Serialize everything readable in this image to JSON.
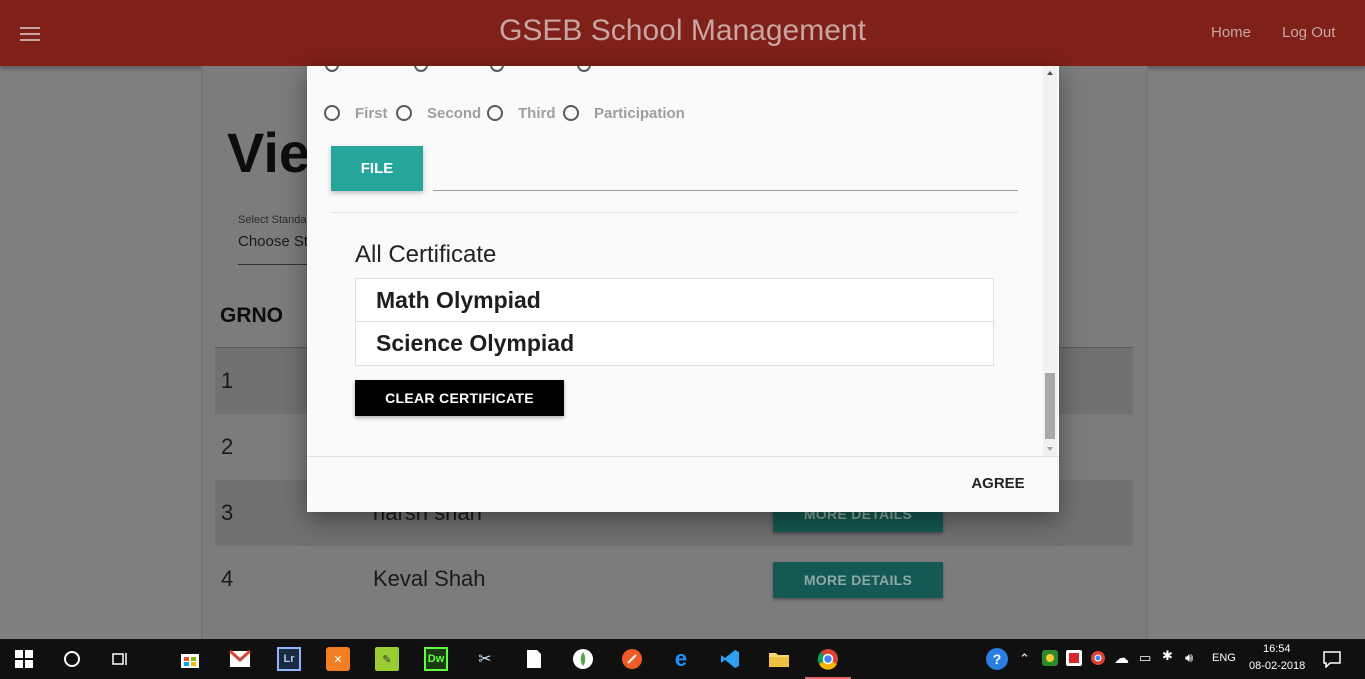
{
  "header": {
    "title": "GSEB School Management",
    "nav": [
      "Home",
      "Log Out"
    ]
  },
  "background_page": {
    "title_visible": "Vie",
    "select_label": "Select Standa",
    "select_value": "Choose Sta",
    "table_header": "GRNO",
    "rows": [
      {
        "grno": "1",
        "name": "",
        "button": ""
      },
      {
        "grno": "2",
        "name": "",
        "button": ""
      },
      {
        "grno": "3",
        "name": "harsh shah",
        "button": "MORE DETAILS"
      },
      {
        "grno": "4",
        "name": "Keval Shah",
        "button": "MORE DETAILS"
      }
    ]
  },
  "modal": {
    "radio_options": [
      "First",
      "Second",
      "Third",
      "Participation"
    ],
    "file_button": "FILE",
    "file_path_value": "",
    "certificates_heading": "All Certificate",
    "certificates": [
      "Math Olympiad",
      "Science Olympiad"
    ],
    "clear_button": "CLEAR CERTIFICATE",
    "agree_button": "AGREE"
  },
  "taskbar": {
    "language": "ENG",
    "time": "16:54",
    "date": "08-02-2018",
    "apps": [
      "windows-start-icon",
      "cortana-icon",
      "task-view-icon",
      "store-icon",
      "gmail-icon",
      "lightroom-icon",
      "xampp-icon",
      "notepad-plus-icon",
      "dreamweaver-icon",
      "snipping-tool-icon",
      "file-icon",
      "mongodb-icon",
      "postman-icon",
      "edge-icon",
      "vscode-icon",
      "file-explorer-icon",
      "chrome-icon"
    ]
  },
  "colors": {
    "header_bg": "#7f2019",
    "primary_teal": "#26a69a",
    "overlay": "#7f7f7f"
  }
}
